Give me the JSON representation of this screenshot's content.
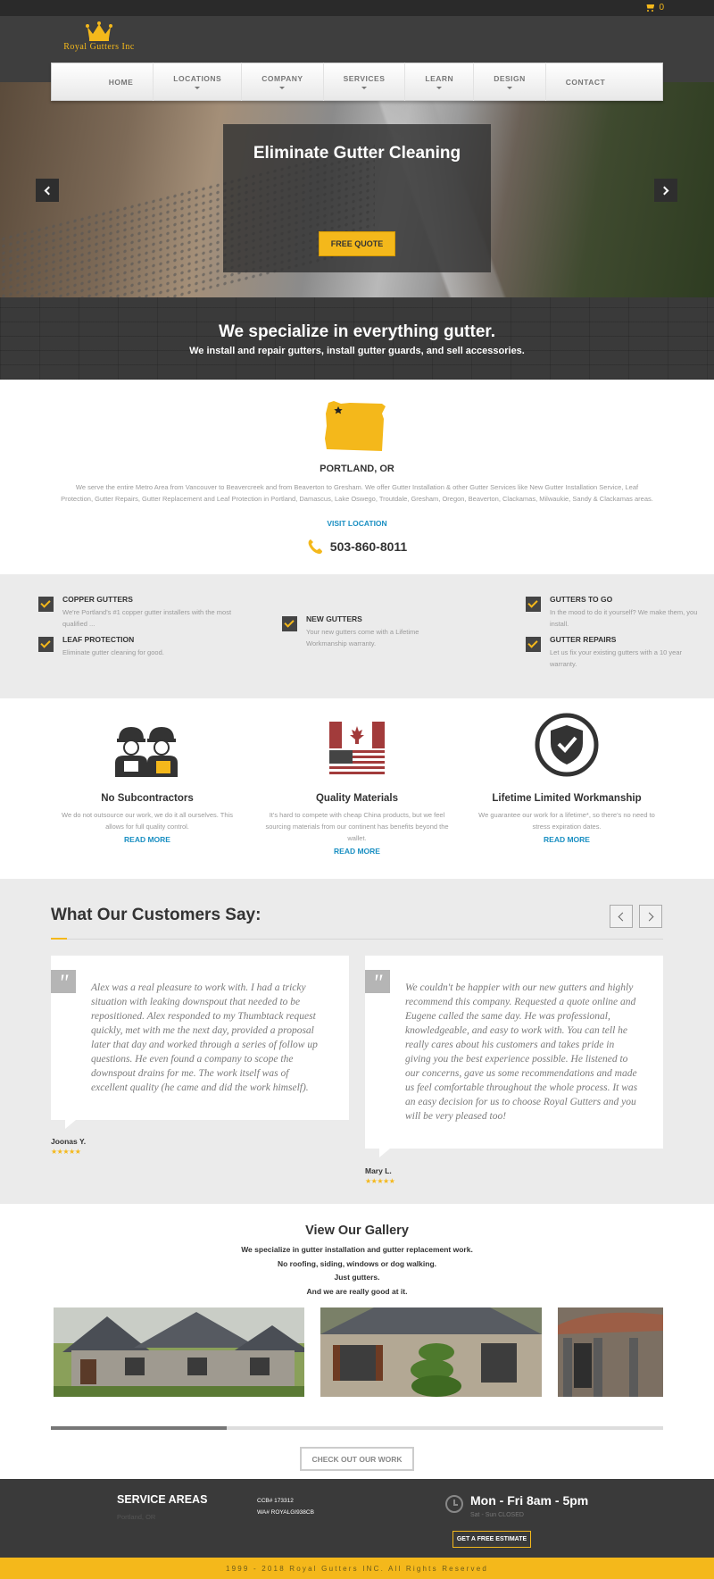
{
  "topbar": {
    "cart_count": "0"
  },
  "brand": {
    "name": "Royal Gutters Inc",
    "accent": "#f4b81b"
  },
  "nav": [
    {
      "label": "HOME",
      "dropdown": false
    },
    {
      "label": "LOCATIONS",
      "dropdown": true
    },
    {
      "label": "COMPANY",
      "dropdown": true
    },
    {
      "label": "SERVICES",
      "dropdown": true
    },
    {
      "label": "LEARN",
      "dropdown": true
    },
    {
      "label": "DESIGN",
      "dropdown": true
    },
    {
      "label": "CONTACT",
      "dropdown": false
    }
  ],
  "hero": {
    "title": "Eliminate Gutter Cleaning",
    "cta": "FREE QUOTE"
  },
  "tagline": {
    "heading": "We specialize in everything gutter.",
    "sub": "We install and repair gutters, install gutter guards, and sell accessories."
  },
  "location": {
    "title": "PORTLAND, OR",
    "description": "We serve the entire Metro Area from Vancouver to Beavercreek and from Beaverton to Gresham. We offer Gutter Installation & other Gutter Services like New Gutter Installation Service, Leaf Protection, Gutter Repairs, Gutter Replacement and Leaf Protection in Portland, Damascus, Lake Oswego, Troutdale, Gresham, Oregon, Beaverton, Clackamas, Milwaukie, Sandy & Clackamas areas.",
    "link": "VISIT LOCATION",
    "phone": "503-860-8011"
  },
  "features": {
    "copper": {
      "title": "COPPER GUTTERS",
      "desc": "We're Portland's #1 copper gutter installers with the most qualified ..."
    },
    "leaf": {
      "title": "LEAF PROTECTION",
      "desc": "Eliminate gutter cleaning for good."
    },
    "new": {
      "title": "NEW GUTTERS",
      "desc": "Your new gutters come with a Lifetime Workmanship warranty."
    },
    "togo": {
      "title": "GUTTERS TO GO",
      "desc": "In the mood to do it yourself? We make them, you install."
    },
    "repairs": {
      "title": "GUTTER REPAIRS",
      "desc": "Let us fix your existing gutters with a 10 year warranty."
    }
  },
  "pillars": [
    {
      "title": "No Subcontractors",
      "desc": "We do not outsource our work, we do it all ourselves. This allows for full quality control.",
      "link": "READ MORE"
    },
    {
      "title": "Quality Materials",
      "desc": "It's hard to compete with cheap China products, but we feel sourcing materials from our continent has benefits beyond the wallet.",
      "link": "READ MORE"
    },
    {
      "title": "Lifetime Limited Workmanship",
      "desc": "We guarantee our work for a lifetime*, so there's no need to stress expiration dates.",
      "link": "READ MORE"
    }
  ],
  "testimonials": {
    "heading": "What Our Customers Say:",
    "items": [
      {
        "text": "Alex was a real pleasure to work with. I had a tricky situation with leaking downspout that needed to be repositioned. Alex responded to my Thumbtack request quickly, met with me the next day, provided a proposal later that day and worked through a series of follow up questions. He even found a company to scope the downspout drains for me. The work itself was of excellent quality (he came and did the work himself).",
        "author": "Joonas Y.",
        "stars": "★★★★★"
      },
      {
        "text": "We couldn't be happier with our new gutters and highly recommend this company. Requested a quote online and Eugene called the same day. He was professional, knowledgeable, and easy to work with. You can tell he really cares about his customers and takes pride in giving you the best experience possible. He listened to our concerns, gave us some recommendations and made us feel comfortable throughout the whole process. It was an easy decision for us to choose Royal Gutters and you will be very pleased too!",
        "author": "Mary L.",
        "stars": "★★★★★"
      }
    ]
  },
  "gallery": {
    "heading": "View Our Gallery",
    "lines": [
      "We specialize in gutter installation and gutter replacement work.",
      "No roofing, siding, windows or dog walking.",
      "Just gutters.",
      "And we are really good at it."
    ],
    "button": "CHECK OUT OUR WORK"
  },
  "footer": {
    "service_heading": "SERVICE AREAS",
    "city": "Portland, OR",
    "ccb": "CCB# 173312",
    "wa": "WA# ROYALGI938CB",
    "hours": "Mon - Fri 8am - 5pm",
    "hours_sub": "Sat - Sun CLOSED",
    "estimate": "GET A FREE ESTIMATE",
    "copyright": "1999 - 2018 Royal Gutters INC. All Rights Reserved"
  }
}
